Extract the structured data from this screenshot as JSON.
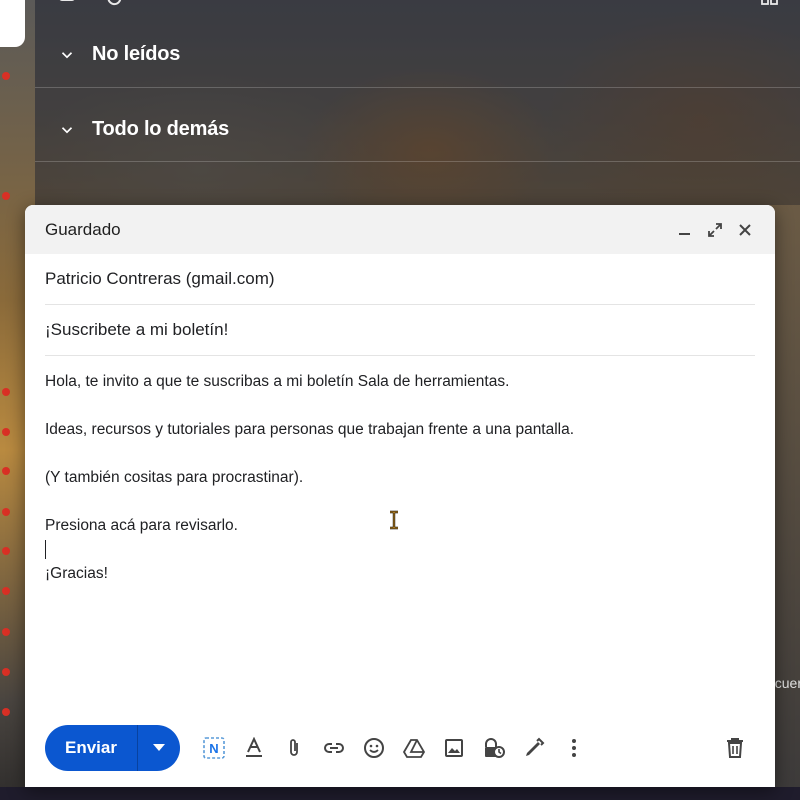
{
  "inbox": {
    "sections": [
      {
        "label": "No leídos"
      },
      {
        "label": "Todo lo demás"
      }
    ],
    "cut_text": "cuer"
  },
  "compose": {
    "title": "Guardado",
    "to": "Patricio Contreras (gmail.com)",
    "subject": "¡Suscribete a mi boletín!",
    "body": {
      "line1": "Hola, te invito a que te suscribas a mi boletín Sala de herramientas.",
      "line2": "Ideas, recursos y tutoriales para personas que trabajan frente a una pantalla.",
      "line3": "(Y también cositas para procrastinar).",
      "line4": "Presiona acá para revisarlo.",
      "line5": "¡Gracias!"
    },
    "send_label": "Enviar",
    "header_icons": [
      "minimize-icon",
      "expand-icon",
      "close-icon"
    ],
    "toolbar_icons": [
      "smart-compose-icon",
      "text-format-icon",
      "attach-icon",
      "link-icon",
      "emoji-icon",
      "drive-icon",
      "image-icon",
      "confidential-mode-icon",
      "signature-icon",
      "more-options-icon",
      "trash-icon"
    ]
  },
  "colors": {
    "send": "#0b57d0",
    "header_bg": "#f2f2f2",
    "accent_dot": "#d93025"
  }
}
